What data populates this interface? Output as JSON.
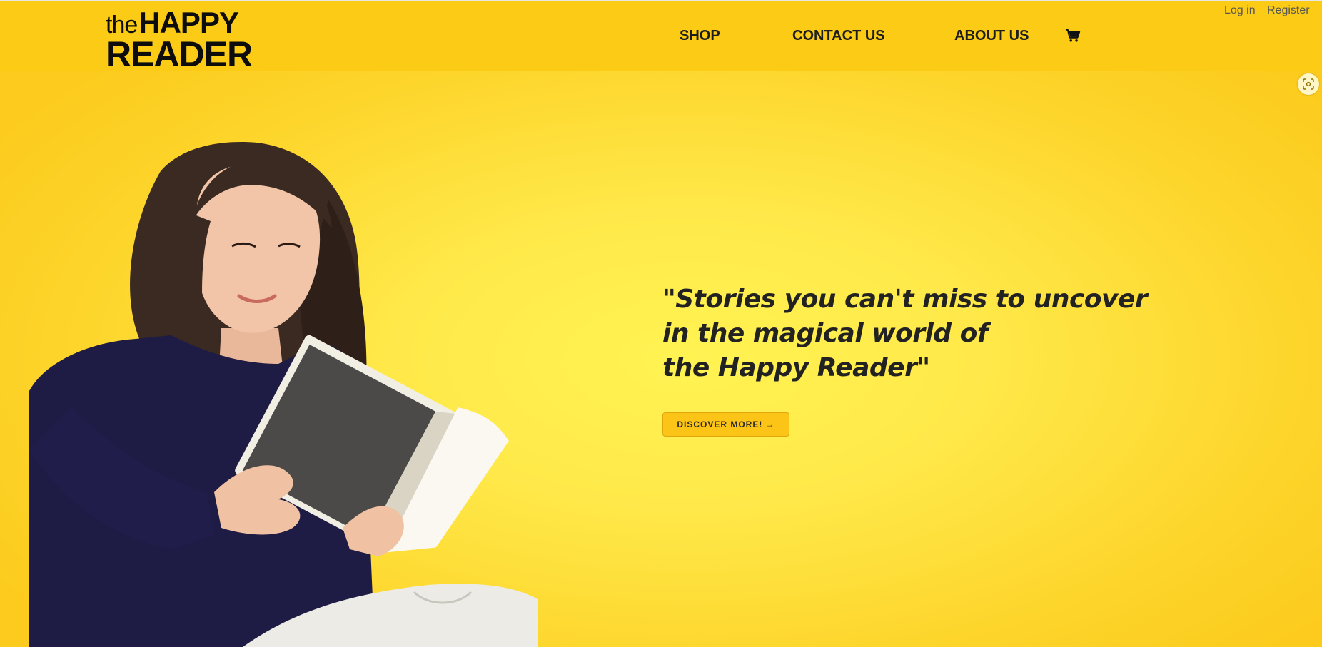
{
  "header": {
    "logo": {
      "the": "the",
      "happy": "HAPPY",
      "reader": "READER"
    },
    "nav": [
      {
        "label": "SHOP"
      },
      {
        "label": "CONTACT US"
      },
      {
        "label": "ABOUT US"
      }
    ],
    "cart_icon": "shopping-cart-icon",
    "auth": {
      "login": "Log in",
      "register": "Register"
    }
  },
  "hero": {
    "quote_lines": [
      "\"Stories you can't miss to uncover",
      "in the magical world of",
      "the Happy Reader\""
    ],
    "cta_label": "DISCOVER MORE! →",
    "image_icon": "woman-reading-book-photo"
  },
  "overlay": {
    "focus_icon": "visual-search-icon"
  },
  "colors": {
    "header_bg": "#fccb16",
    "hero_center": "#fff352",
    "hero_edge": "#fccb1e",
    "button_bg": "#fcc416",
    "text_dark": "#222222"
  }
}
